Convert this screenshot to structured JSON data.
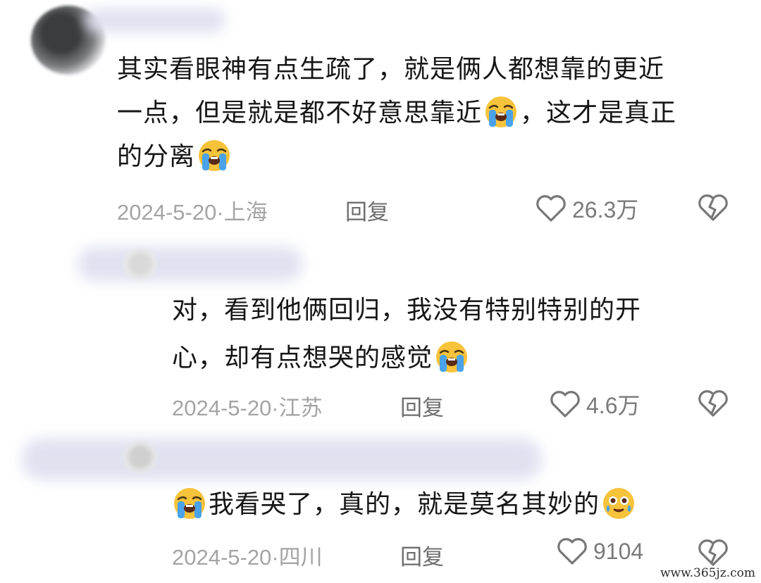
{
  "comments": [
    {
      "lines": [
        "其实看眼神有点生疏了，就是俩人都想靠的更近",
        "一点，但是就是都不好意思靠近",
        "，这才是真正",
        "的分离"
      ],
      "date": "2024-5-20",
      "location": "上海",
      "reply_label": "回复",
      "likes": "26.3万"
    },
    {
      "lines": [
        "对，看到他俩回归，我没有特别特别的开",
        "心，却有点想哭的感觉"
      ],
      "date": "2024-5-20",
      "location": "江苏",
      "reply_label": "回复",
      "likes": "4.6万"
    },
    {
      "lines": [
        "我看哭了，真的，就是莫名其妙的"
      ],
      "date": "2024-5-20",
      "location": "四川",
      "reply_label": "回复",
      "likes": "9104"
    }
  ],
  "icons": {
    "like": "heart-outline-icon",
    "dislike": "broken-heart-icon",
    "emoji_cry": "loudly-crying-face-emoji",
    "emoji_tears": "face-holding-back-tears-emoji"
  },
  "watermark": "www.365jz.com"
}
